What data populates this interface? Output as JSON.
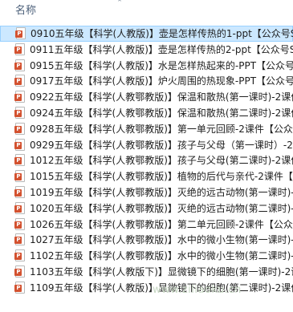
{
  "header": {
    "name_column": "名称"
  },
  "files": [
    {
      "name": "0910五年级【科学(人教版)】壶是怎样传热的1-ppt【公众号S",
      "selected": true
    },
    {
      "name": "0911五年级【科学(人教版)】壶是怎样传热的2-ppt【公众号S",
      "selected": false
    },
    {
      "name": "0915五年级【科学(人教版)】水是怎样热起来的-PPT【公众号",
      "selected": false
    },
    {
      "name": "0917五年级【科学(人教版)】炉火周围的热现象-PPT【公众号",
      "selected": false
    },
    {
      "name": "0922五年级【科学(人教鄂教版)】保温和散热(第一课时)-2课件",
      "selected": false
    },
    {
      "name": "0924五年级【科学(人教鄂教版)】保温和散热(第二课时)-2课件",
      "selected": false
    },
    {
      "name": "0928五年级【科学(人教鄂教版)】第一单元回顾-2课件【公众号",
      "selected": false
    },
    {
      "name": "0929五年级【科学(人教鄂教版)】孩子与父母（第一课时）-2课件",
      "selected": false
    },
    {
      "name": "1012五年级【科学(人教鄂教版)】孩子与父母(第二课时)-2课件",
      "selected": false
    },
    {
      "name": "1015五年级【科学(人教鄂教版)】植物的后代与亲代-2课件【公",
      "selected": false
    },
    {
      "name": "1019五年级【科学(人教鄂教版)】灭绝的远古动物(第一课时)-2课",
      "selected": false
    },
    {
      "name": "1020五年级【科学(人教鄂教版)】灭绝的远古动物(第二课时)-2课",
      "selected": false
    },
    {
      "name": "1026五年级【科学(人教鄂教版)】第二单元回顾-2课件【公众号",
      "selected": false
    },
    {
      "name": "1027五年级【科学(人教鄂教版)】水中的微小生物(第一课时)-2课",
      "selected": false
    },
    {
      "name": "1102五年级【科学(人教鄂教版)】水中的微小生物(第二课时)-2课",
      "selected": false
    },
    {
      "name": "1103五年级【科学(人教版下)】显微镜下的细胞(第一课时)-2课件",
      "selected": false
    },
    {
      "name": "1109五年级【科学(人教版)】显微镜下的细胞(第二课时)-2课件",
      "selected": false
    }
  ],
  "watermark": "www.ziliaoku.cn",
  "colors": {
    "selection_bg": "#cce8ff",
    "selection_border": "#99d1ff",
    "header_text": "#4c607a",
    "ppt_icon": "#d35230"
  },
  "icons": {
    "file": "powerpoint-file-icon",
    "sort": "sort-up-icon"
  }
}
